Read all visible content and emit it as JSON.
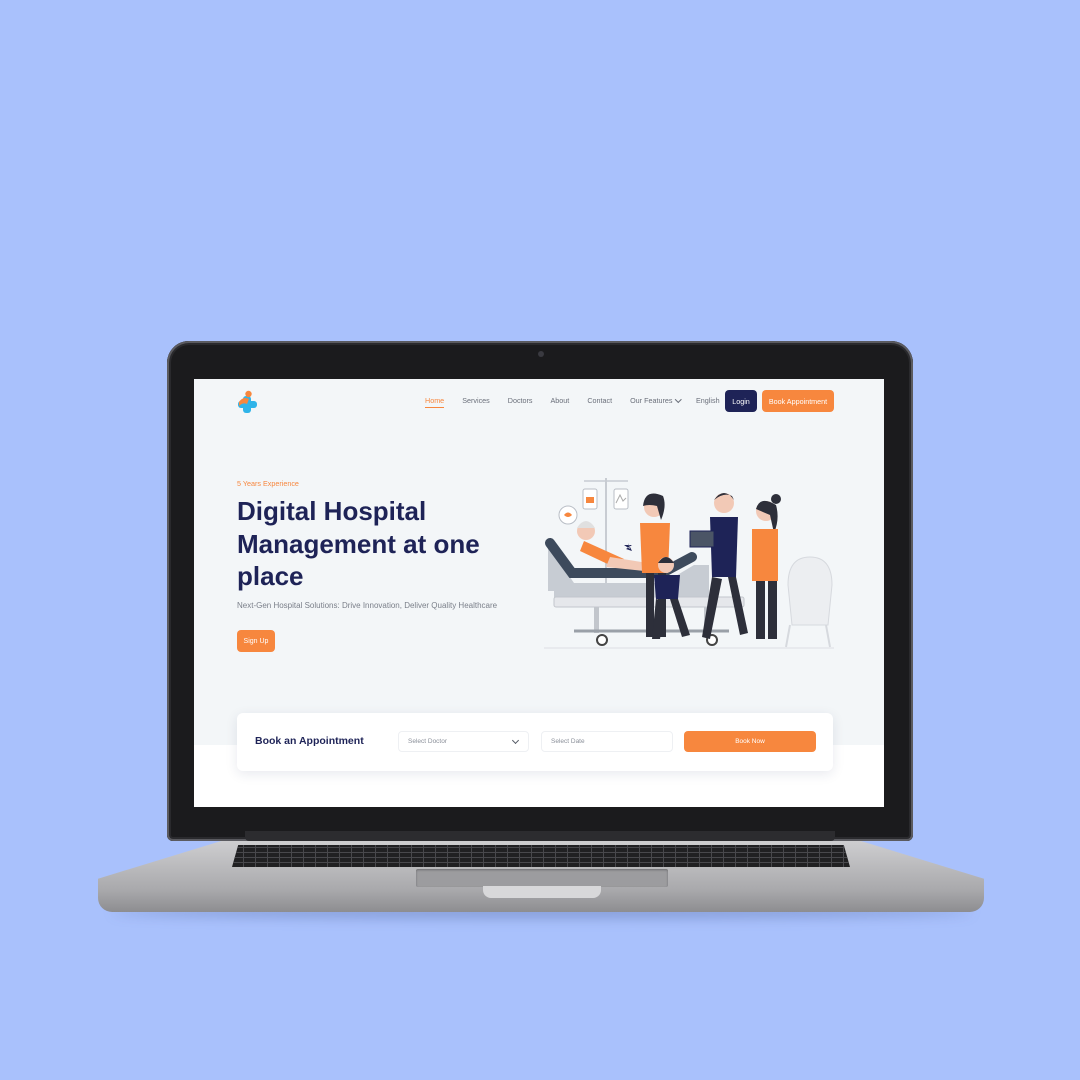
{
  "nav": {
    "items": [
      {
        "label": "Home",
        "active": true
      },
      {
        "label": "Services",
        "active": false
      },
      {
        "label": "Doctors",
        "active": false
      },
      {
        "label": "About",
        "active": false
      },
      {
        "label": "Contact",
        "active": false
      },
      {
        "label": "Our Features",
        "active": false,
        "dropdown": true
      }
    ],
    "language": "English",
    "login_label": "Login",
    "book_label": "Book Appointment"
  },
  "hero": {
    "eyebrow": "5 Years Experience",
    "title": "Digital Hospital Management at one place",
    "subtitle": "Next-Gen Hospital Solutions: Drive Innovation, Deliver Quality Healthcare",
    "signup_label": "Sign Up"
  },
  "appointment": {
    "title": "Book an Appointment",
    "doctor_placeholder": "Select Doctor",
    "date_placeholder": "Select Date",
    "submit_label": "Book Now"
  },
  "colors": {
    "background": "#a9c1fc",
    "brand_navy": "#1e2357",
    "accent_orange": "#f7873e",
    "page_bg": "#f3f6f8"
  },
  "icons": [
    "logo-icon",
    "chevron-down-icon",
    "hospital-family-illustration"
  ]
}
